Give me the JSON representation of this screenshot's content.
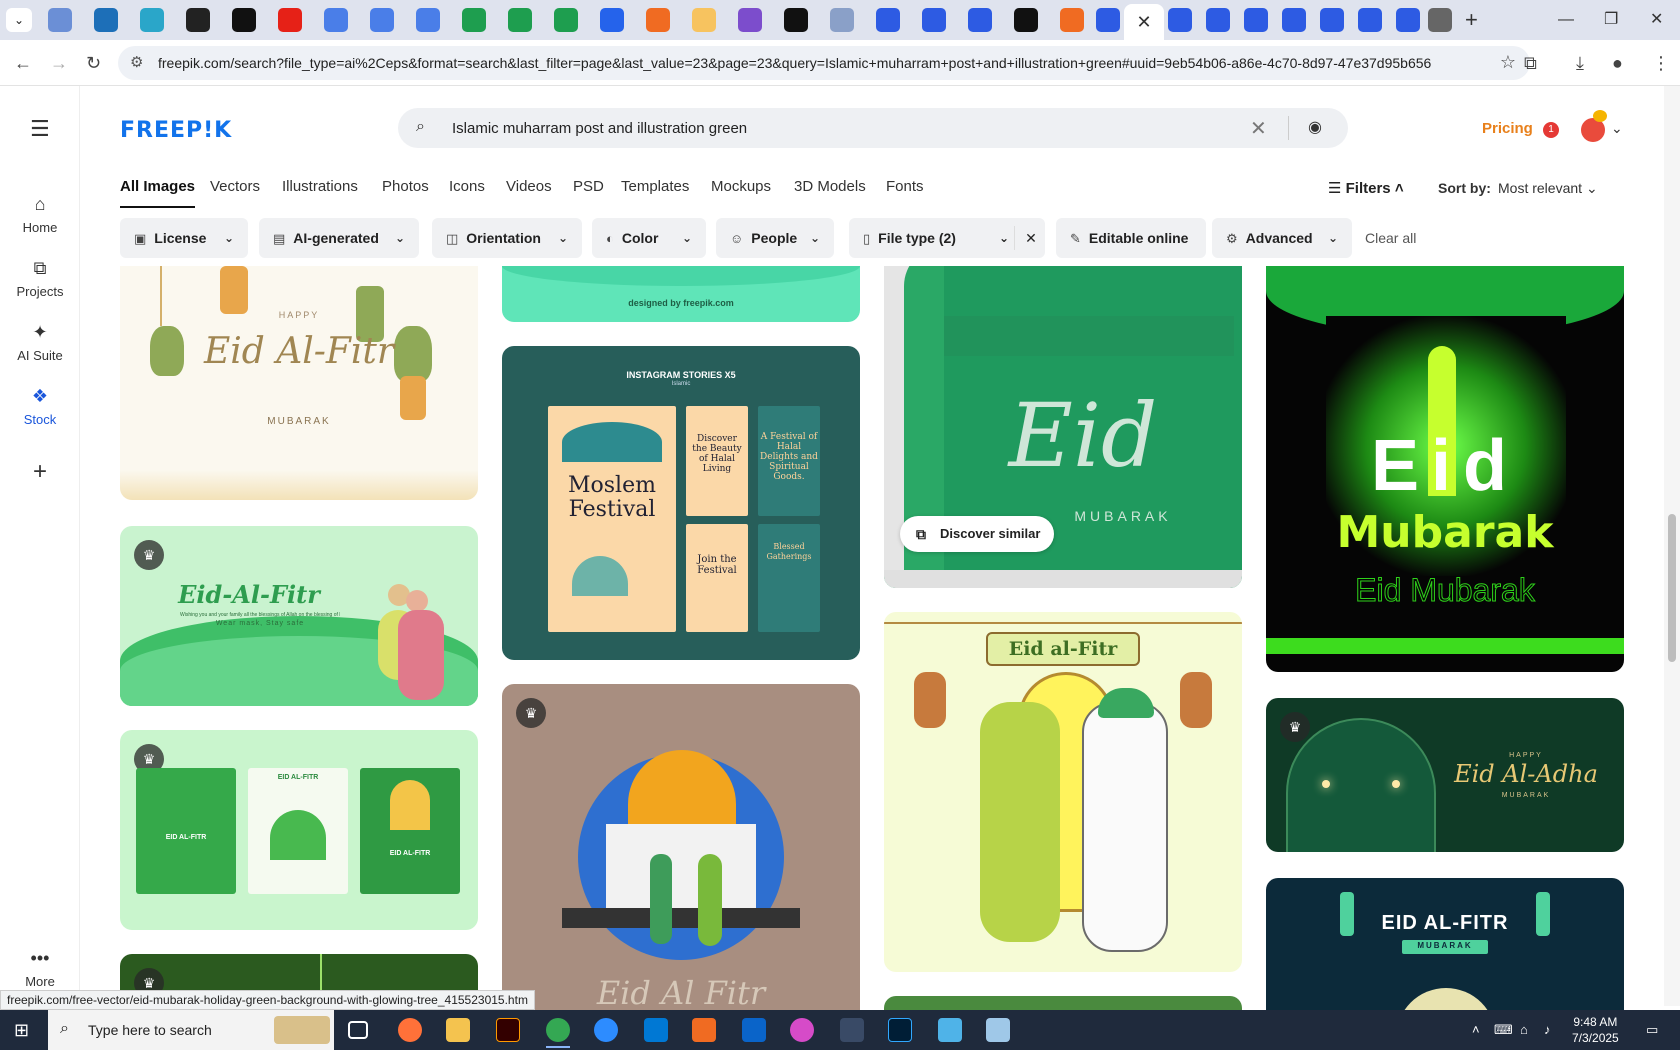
{
  "browser": {
    "active_tab_close": "✕",
    "new_tab": "+",
    "url": "freepik.com/search?file_type=ai%2Ceps&format=search&last_filter=page&last_value=23&page=23&query=Islamic+muharram+post+and+illustration+green#uuid=9eb54b06-a86e-4c70-8d97-47e37d95b656",
    "status_url": "freepik.com/free-vector/eid-mubarak-holiday-green-background-with-glowing-tree_415523015.htm"
  },
  "rail": {
    "items": [
      {
        "label": "Home",
        "icon": "home-icon"
      },
      {
        "label": "Projects",
        "icon": "projects-icon"
      },
      {
        "label": "AI Suite",
        "icon": "sparkle-icon"
      },
      {
        "label": "Stock",
        "icon": "stock-icon"
      }
    ],
    "more_label": "More"
  },
  "header": {
    "logo": "FREEP!K",
    "search_value": "Islamic muharram post and illustration green",
    "pricing": "Pricing",
    "notification_count": "1"
  },
  "categories": [
    "All Images",
    "Vectors",
    "Illustrations",
    "Photos",
    "Icons",
    "Videos",
    "PSD",
    "Templates",
    "Mockups",
    "3D Models",
    "Fonts"
  ],
  "filters_label": "Filters",
  "sort": {
    "label": "Sort by:",
    "value": "Most relevant"
  },
  "pills": [
    "License",
    "AI-generated",
    "Orientation",
    "Color",
    "People",
    "File type (2)",
    "Editable online",
    "Advanced"
  ],
  "clear_all": "Clear all",
  "cards": {
    "c1": {
      "small": "HAPPY",
      "title": "Eid Al-Fitr",
      "sub": "MUBARAK"
    },
    "c2": {
      "title": "Eid-Al-Fitr",
      "sub": "Wishing you and your family all the blessings of Allah on the blessing of Eid",
      "sub2": "Wear mask, Stay safe"
    },
    "c3": {
      "p1": "EID AL-FITR",
      "p2": "EID AL-FITR",
      "p3": "EID AL-FITR"
    },
    "c4": {
      "footer": "designed by freepik.com"
    },
    "c5": {
      "head": "INSTAGRAM STORIES X5",
      "head2": "Islamic",
      "title": "Moslem Festival",
      "s1": "Discover the Beauty of Halal Living",
      "s2": "A Festival of Halal Delights and Spiritual Goods.",
      "s3": "Join the Festival",
      "s4": "Blessed Gatherings"
    },
    "c6": {
      "title": "Eid Al Fitr"
    },
    "c7": {
      "title": "Eid",
      "sub": "MUBARAK",
      "discover": "Discover similar"
    },
    "c8": {
      "title": "Eid al-Fitr"
    },
    "c9": {
      "title": "Eid",
      "title2": "Mubarak",
      "sub": "Eid Mubarak"
    },
    "c10": {
      "small": "HAPPY",
      "title": "Eid Al-Adha",
      "sub": "MUBARAK"
    },
    "c11": {
      "title": "EID AL-FITR",
      "sub": "MUBARAK"
    }
  },
  "taskbar": {
    "search_placeholder": "Type here to search",
    "time": "9:48 AM",
    "date": "7/3/2025"
  }
}
